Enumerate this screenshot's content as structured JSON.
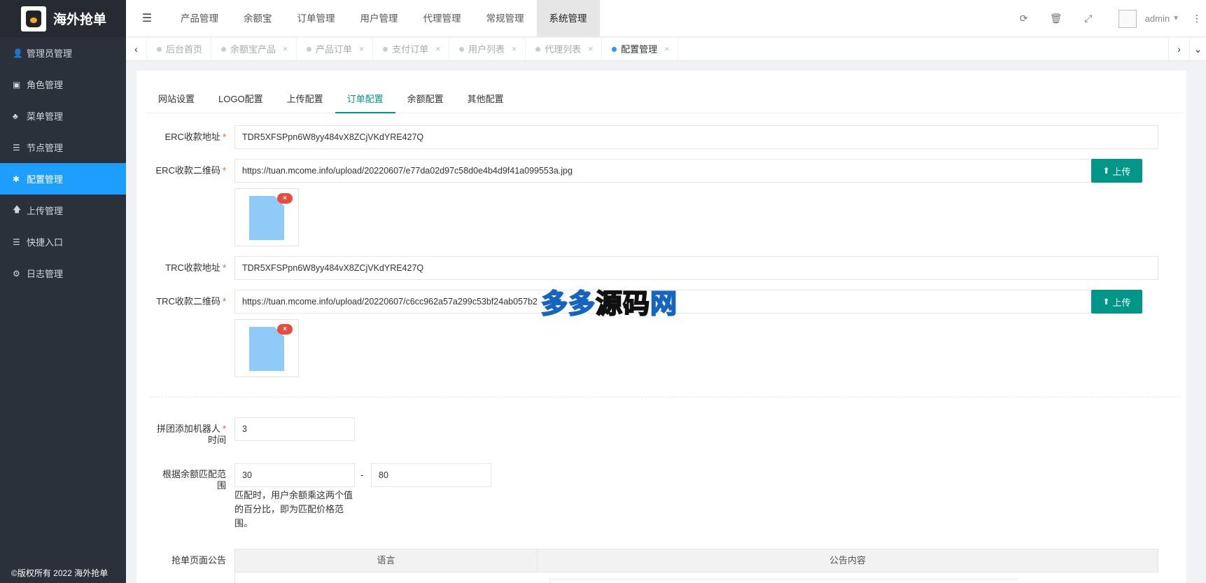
{
  "brand": {
    "title": "海外抢单"
  },
  "sidebar": {
    "items": [
      {
        "label": "管理员管理",
        "icon": "user-icon",
        "glyph": "👤"
      },
      {
        "label": "角色管理",
        "icon": "role-icon",
        "glyph": "▣"
      },
      {
        "label": "菜单管理",
        "icon": "tree-icon",
        "glyph": "♣"
      },
      {
        "label": "节点管理",
        "icon": "list-icon",
        "glyph": "☰"
      },
      {
        "label": "配置管理",
        "icon": "asterisk-icon",
        "glyph": "✱",
        "active": true
      },
      {
        "label": "上传管理",
        "icon": "arrow-up-icon",
        "glyph": "🡅"
      },
      {
        "label": "快捷入口",
        "icon": "list-icon",
        "glyph": "☰"
      },
      {
        "label": "日志管理",
        "icon": "log-icon",
        "glyph": "⚙"
      }
    ],
    "footer": "©版权所有 2022 海外抢单"
  },
  "topnav": {
    "items": [
      "产品管理",
      "余额宝",
      "订单管理",
      "用户管理",
      "代理管理",
      "常规管理",
      "系统管理"
    ],
    "active_index": 6,
    "user": "admin"
  },
  "page_tabs": [
    {
      "label": "后台首页",
      "closable": false
    },
    {
      "label": "余额宝产品",
      "closable": true
    },
    {
      "label": "产品订单",
      "closable": true
    },
    {
      "label": "支付订单",
      "closable": true
    },
    {
      "label": "用户列表",
      "closable": true
    },
    {
      "label": "代理列表",
      "closable": true
    },
    {
      "label": "配置管理",
      "closable": true,
      "active": true
    }
  ],
  "subtabs": {
    "items": [
      "网站设置",
      "LOGO配置",
      "上传配置",
      "订单配置",
      "余额配置",
      "其他配置"
    ],
    "active_index": 3
  },
  "form": {
    "erc_address": {
      "label": "ERC收款地址",
      "value": "TDR5XFSPpn6W8yy484vX8ZCjVKdYRE427Q"
    },
    "erc_qrcode": {
      "label": "ERC收款二维码",
      "value": "https://tuan.mcome.info/upload/20220607/e77da02d97c58d0e4b4d9f41a099553a.jpg"
    },
    "trc_address": {
      "label": "TRC收款地址",
      "value": "TDR5XFSPpn6W8yy484vX8ZCjVKdYRE427Q"
    },
    "trc_qrcode": {
      "label": "TRC收款二维码",
      "value": "https://tuan.mcome.info/upload/20220607/c6cc962a57a299c53bf24ab057b2"
    },
    "upload_label": "上传",
    "remove_label": "×",
    "robot_time": {
      "label_line1": "拼团添加机器人",
      "label_line2": "时间",
      "value": "3"
    },
    "balance_range": {
      "label_line1": "根据余额匹配范",
      "label_line2": "围",
      "min": "30",
      "max": "80",
      "separator": "-",
      "help_lines": [
        "匹配时，用户余额乘这两个值",
        "的百分比，即为匹配价格范",
        "围。"
      ]
    },
    "notice": {
      "label": "抢单页面公告",
      "col_language": "语言",
      "col_content": "公告内容"
    }
  },
  "watermark": {
    "part1": "源码",
    "part2": "网",
    "prefix": "多多"
  }
}
